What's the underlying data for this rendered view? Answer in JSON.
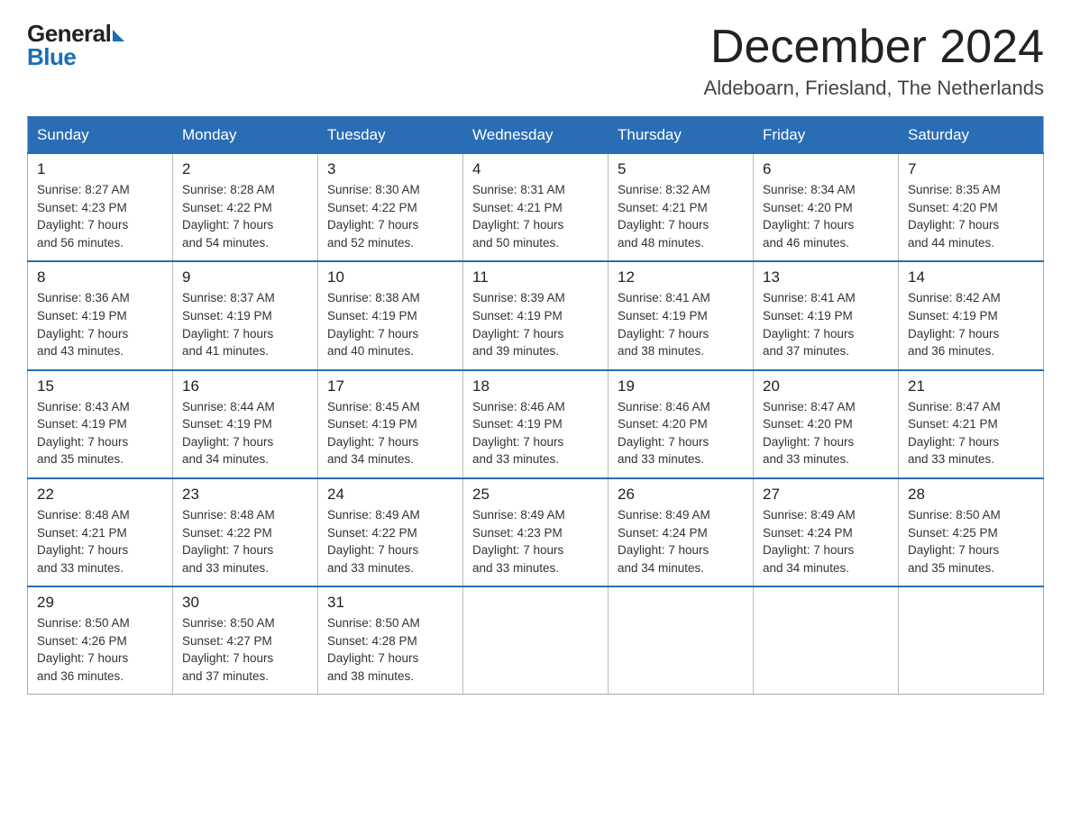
{
  "logo": {
    "general": "General",
    "blue": "Blue"
  },
  "header": {
    "month": "December 2024",
    "location": "Aldeboarn, Friesland, The Netherlands"
  },
  "weekdays": [
    "Sunday",
    "Monday",
    "Tuesday",
    "Wednesday",
    "Thursday",
    "Friday",
    "Saturday"
  ],
  "weeks": [
    [
      {
        "day": "1",
        "sunrise": "8:27 AM",
        "sunset": "4:23 PM",
        "daylight": "7 hours and 56 minutes."
      },
      {
        "day": "2",
        "sunrise": "8:28 AM",
        "sunset": "4:22 PM",
        "daylight": "7 hours and 54 minutes."
      },
      {
        "day": "3",
        "sunrise": "8:30 AM",
        "sunset": "4:22 PM",
        "daylight": "7 hours and 52 minutes."
      },
      {
        "day": "4",
        "sunrise": "8:31 AM",
        "sunset": "4:21 PM",
        "daylight": "7 hours and 50 minutes."
      },
      {
        "day": "5",
        "sunrise": "8:32 AM",
        "sunset": "4:21 PM",
        "daylight": "7 hours and 48 minutes."
      },
      {
        "day": "6",
        "sunrise": "8:34 AM",
        "sunset": "4:20 PM",
        "daylight": "7 hours and 46 minutes."
      },
      {
        "day": "7",
        "sunrise": "8:35 AM",
        "sunset": "4:20 PM",
        "daylight": "7 hours and 44 minutes."
      }
    ],
    [
      {
        "day": "8",
        "sunrise": "8:36 AM",
        "sunset": "4:19 PM",
        "daylight": "7 hours and 43 minutes."
      },
      {
        "day": "9",
        "sunrise": "8:37 AM",
        "sunset": "4:19 PM",
        "daylight": "7 hours and 41 minutes."
      },
      {
        "day": "10",
        "sunrise": "8:38 AM",
        "sunset": "4:19 PM",
        "daylight": "7 hours and 40 minutes."
      },
      {
        "day": "11",
        "sunrise": "8:39 AM",
        "sunset": "4:19 PM",
        "daylight": "7 hours and 39 minutes."
      },
      {
        "day": "12",
        "sunrise": "8:41 AM",
        "sunset": "4:19 PM",
        "daylight": "7 hours and 38 minutes."
      },
      {
        "day": "13",
        "sunrise": "8:41 AM",
        "sunset": "4:19 PM",
        "daylight": "7 hours and 37 minutes."
      },
      {
        "day": "14",
        "sunrise": "8:42 AM",
        "sunset": "4:19 PM",
        "daylight": "7 hours and 36 minutes."
      }
    ],
    [
      {
        "day": "15",
        "sunrise": "8:43 AM",
        "sunset": "4:19 PM",
        "daylight": "7 hours and 35 minutes."
      },
      {
        "day": "16",
        "sunrise": "8:44 AM",
        "sunset": "4:19 PM",
        "daylight": "7 hours and 34 minutes."
      },
      {
        "day": "17",
        "sunrise": "8:45 AM",
        "sunset": "4:19 PM",
        "daylight": "7 hours and 34 minutes."
      },
      {
        "day": "18",
        "sunrise": "8:46 AM",
        "sunset": "4:19 PM",
        "daylight": "7 hours and 33 minutes."
      },
      {
        "day": "19",
        "sunrise": "8:46 AM",
        "sunset": "4:20 PM",
        "daylight": "7 hours and 33 minutes."
      },
      {
        "day": "20",
        "sunrise": "8:47 AM",
        "sunset": "4:20 PM",
        "daylight": "7 hours and 33 minutes."
      },
      {
        "day": "21",
        "sunrise": "8:47 AM",
        "sunset": "4:21 PM",
        "daylight": "7 hours and 33 minutes."
      }
    ],
    [
      {
        "day": "22",
        "sunrise": "8:48 AM",
        "sunset": "4:21 PM",
        "daylight": "7 hours and 33 minutes."
      },
      {
        "day": "23",
        "sunrise": "8:48 AM",
        "sunset": "4:22 PM",
        "daylight": "7 hours and 33 minutes."
      },
      {
        "day": "24",
        "sunrise": "8:49 AM",
        "sunset": "4:22 PM",
        "daylight": "7 hours and 33 minutes."
      },
      {
        "day": "25",
        "sunrise": "8:49 AM",
        "sunset": "4:23 PM",
        "daylight": "7 hours and 33 minutes."
      },
      {
        "day": "26",
        "sunrise": "8:49 AM",
        "sunset": "4:24 PM",
        "daylight": "7 hours and 34 minutes."
      },
      {
        "day": "27",
        "sunrise": "8:49 AM",
        "sunset": "4:24 PM",
        "daylight": "7 hours and 34 minutes."
      },
      {
        "day": "28",
        "sunrise": "8:50 AM",
        "sunset": "4:25 PM",
        "daylight": "7 hours and 35 minutes."
      }
    ],
    [
      {
        "day": "29",
        "sunrise": "8:50 AM",
        "sunset": "4:26 PM",
        "daylight": "7 hours and 36 minutes."
      },
      {
        "day": "30",
        "sunrise": "8:50 AM",
        "sunset": "4:27 PM",
        "daylight": "7 hours and 37 minutes."
      },
      {
        "day": "31",
        "sunrise": "8:50 AM",
        "sunset": "4:28 PM",
        "daylight": "7 hours and 38 minutes."
      },
      null,
      null,
      null,
      null
    ]
  ],
  "labels": {
    "sunrise": "Sunrise:",
    "sunset": "Sunset:",
    "daylight": "Daylight:"
  }
}
